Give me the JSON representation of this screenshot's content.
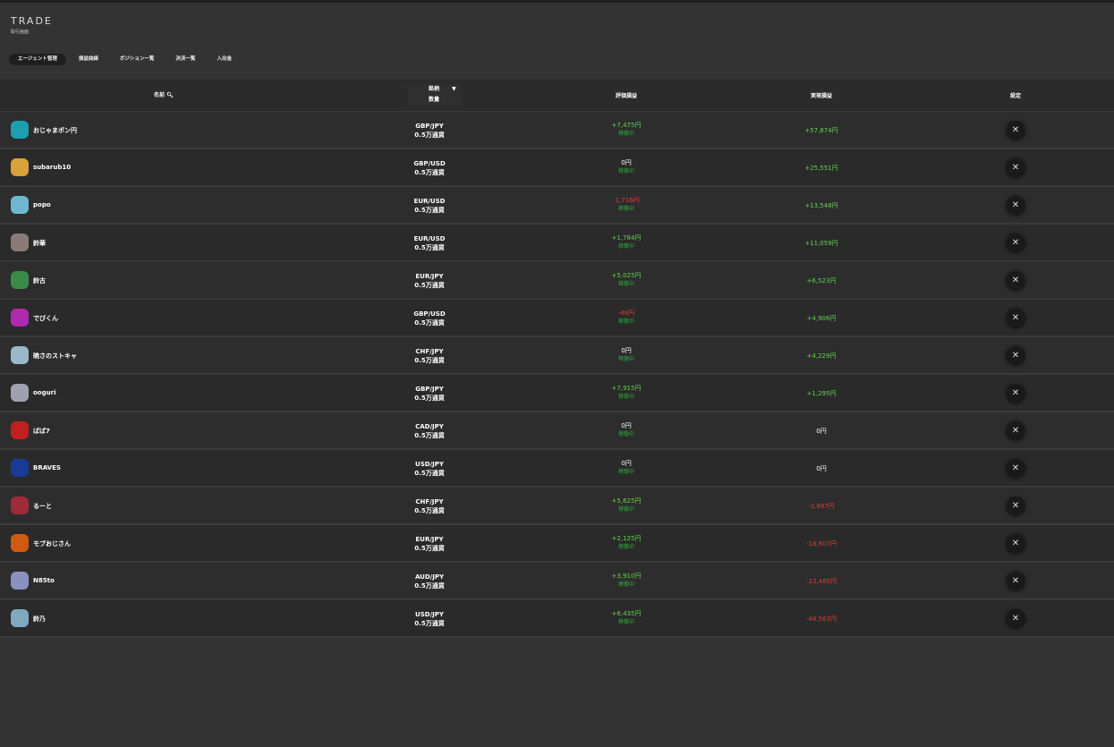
{
  "header": {
    "title": "TRADE",
    "subtitle": "取引画面"
  },
  "tabs": [
    {
      "label": "エージェント管理",
      "active": true
    },
    {
      "label": "損益曲線"
    },
    {
      "label": "ポジション一覧"
    },
    {
      "label": "決済一覧"
    },
    {
      "label": "入出金"
    }
  ],
  "columns": {
    "name": "名前",
    "symbol": "銘柄",
    "quantity": "数量",
    "eval": "評価損益",
    "realized": "実現損益",
    "settings": "設定"
  },
  "icons": {
    "search": "search-icon",
    "filter": "filter-icon",
    "settings": "tools-icon"
  },
  "colors": {
    "positive": "#5fd64a",
    "negative": "#e53935",
    "status": "#2aa83a"
  },
  "rows": [
    {
      "name": "おじゃまポン円",
      "symbol": "GBP/JPY",
      "qty": "0.5万通貨",
      "eval": "+7,475円",
      "status": "稼働中",
      "realized": "+57,874円",
      "avatar": "#1aa0b0"
    },
    {
      "name": "subarub10",
      "symbol": "GBP/USD",
      "qty": "0.5万通貨",
      "eval": "0円",
      "status": "稼働中",
      "realized": "+25,551円",
      "avatar": "#d9a13a"
    },
    {
      "name": "popo",
      "symbol": "EUR/USD",
      "qty": "0.5万通貨",
      "eval": "-1,716円",
      "status": "稼働中",
      "realized": "+13,548円",
      "avatar": "#6fb7d0"
    },
    {
      "name": "鈴華",
      "symbol": "EUR/USD",
      "qty": "0.5万通貨",
      "eval": "+1,784円",
      "status": "稼働中",
      "realized": "+11,059円",
      "avatar": "#8a7a78"
    },
    {
      "name": "鈴古",
      "symbol": "EUR/JPY",
      "qty": "0.5万通貨",
      "eval": "+5,025円",
      "status": "稼働中",
      "realized": "+6,523円",
      "avatar": "#3a8a4a"
    },
    {
      "name": "でびくん",
      "symbol": "GBP/USD",
      "qty": "0.5万通貨",
      "eval": "-48円",
      "status": "稼働中",
      "realized": "+4,906円",
      "avatar": "#b02ab0"
    },
    {
      "name": "暁さのストキャ",
      "symbol": "CHF/JPY",
      "qty": "0.5万通貨",
      "eval": "0円",
      "status": "稼働中",
      "realized": "+4,229円",
      "avatar": "#9ab8c8"
    },
    {
      "name": "ooguri",
      "symbol": "GBP/JPY",
      "qty": "0.5万通貨",
      "eval": "+7,915円",
      "status": "稼働中",
      "realized": "+1,295円",
      "avatar": "#a0a0b0"
    },
    {
      "name": "ぱぱ7",
      "symbol": "CAD/JPY",
      "qty": "0.5万通貨",
      "eval": "0円",
      "status": "稼働中",
      "realized": "0円",
      "avatar": "#c02020"
    },
    {
      "name": "BRAVES",
      "symbol": "USD/JPY",
      "qty": "0.5万通貨",
      "eval": "0円",
      "status": "稼働中",
      "realized": "0円",
      "avatar": "#1a3a9a"
    },
    {
      "name": "るーと",
      "symbol": "CHF/JPY",
      "qty": "0.5万通貨",
      "eval": "+5,625円",
      "status": "稼働中",
      "realized": "-2,897円",
      "avatar": "#a02a3a"
    },
    {
      "name": "モブおじさん",
      "symbol": "EUR/JPY",
      "qty": "0.5万通貨",
      "eval": "+2,125円",
      "status": "稼働中",
      "realized": "-18,807円",
      "avatar": "#d05a10"
    },
    {
      "name": "N85to",
      "symbol": "AUD/JPY",
      "qty": "0.5万通貨",
      "eval": "+3,910円",
      "status": "稼働中",
      "realized": "-23,485円",
      "avatar": "#8a90c0"
    },
    {
      "name": "鈴乃",
      "symbol": "USD/JPY",
      "qty": "0.5万通貨",
      "eval": "+6,435円",
      "status": "稼働中",
      "realized": "-48,563円",
      "avatar": "#80a8c0"
    }
  ]
}
